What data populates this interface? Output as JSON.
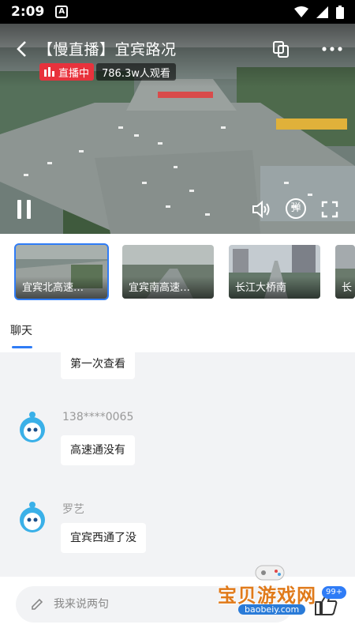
{
  "status_bar": {
    "time": "2:09",
    "notification_icon": "A"
  },
  "video": {
    "title": "【慢直播】宜宾路况",
    "live_label": "直播中",
    "viewers": "786.3w人观看",
    "danmu_label": "弹"
  },
  "cameras": [
    {
      "label": "宜宾北高速…",
      "active": true
    },
    {
      "label": "宜宾南高速…",
      "active": false
    },
    {
      "label": "长江大桥南",
      "active": false
    },
    {
      "label": "长",
      "active": false
    }
  ],
  "tabs": {
    "chat": "聊天"
  },
  "chat": {
    "messages": [
      {
        "user": "",
        "text": "第一次查看"
      },
      {
        "user": "138****0065",
        "text": "高速通没有"
      },
      {
        "user": "罗艺",
        "text": "宜宾西通了没"
      }
    ]
  },
  "input": {
    "placeholder": "我来说两句",
    "like_count": "99+"
  },
  "watermark": {
    "brand": "宝贝游戏网",
    "url": "baobeiy.com"
  },
  "colors": {
    "accent": "#2f7cf6",
    "live": "#e8323c",
    "background": "#f2f3f5"
  }
}
